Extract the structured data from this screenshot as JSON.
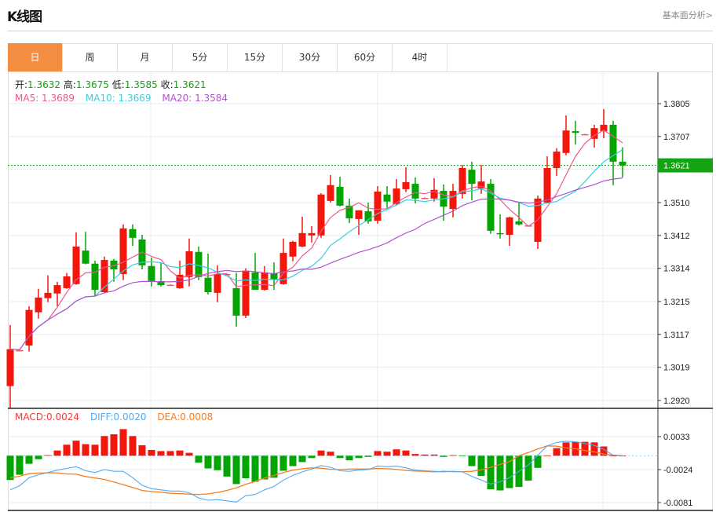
{
  "header": {
    "title": "K线图",
    "link": "基本面分析>"
  },
  "tabs": [
    {
      "label": "日",
      "active": true
    },
    {
      "label": "周"
    },
    {
      "label": "月"
    },
    {
      "label": "5分"
    },
    {
      "label": "15分"
    },
    {
      "label": "30分"
    },
    {
      "label": "60分"
    },
    {
      "label": "4时"
    }
  ],
  "ohlc_info": {
    "open_label": "开:",
    "open": "1.3632",
    "high_label": "高:",
    "high": "1.3675",
    "low_label": "低:",
    "low": "1.3585",
    "close_label": "收:",
    "close": "1.3621"
  },
  "ma_info": {
    "ma5": "MA5: 1.3689",
    "ma10": "MA10: 1.3669",
    "ma20": "MA20: 1.3584"
  },
  "macd_info": {
    "macd": "MACD:0.0024",
    "diff": "DIFF:0.0020",
    "dea": "DEA:0.0008"
  },
  "colors": {
    "up": "#f3160b",
    "down": "#02a502",
    "doji": "#f05a5a",
    "ma5": "#f2578d",
    "ma10": "#3ccde0",
    "ma20": "#b154cc",
    "diff": "#55aaf0",
    "dea": "#f57e22",
    "current": "#13a313",
    "accent": "#f38d3f"
  },
  "chart_data": {
    "type": "candlestick",
    "price_axis": {
      "ticks": [
        "1.3805",
        "1.3707",
        "1.3610",
        "1.3510",
        "1.3412",
        "1.3314",
        "1.3215",
        "1.3117",
        "1.3019",
        "1.2920"
      ],
      "range": [
        1.292,
        1.3805
      ]
    },
    "current_price": "1.3621",
    "candles_ohlc": [
      [
        1.2963,
        1.3145,
        1.2897,
        1.3073
      ],
      [
        1.307,
        1.3072,
        1.3068,
        1.307
      ],
      [
        1.3084,
        1.3201,
        1.3066,
        1.319
      ],
      [
        1.3183,
        1.3253,
        1.3164,
        1.3227
      ],
      [
        1.3225,
        1.3293,
        1.3213,
        1.3241
      ],
      [
        1.3239,
        1.3274,
        1.3201,
        1.3264
      ],
      [
        1.3255,
        1.33,
        1.3253,
        1.329
      ],
      [
        1.3267,
        1.3421,
        1.3265,
        1.3379
      ],
      [
        1.3367,
        1.3423,
        1.3326,
        1.3328
      ],
      [
        1.3328,
        1.3337,
        1.3232,
        1.325
      ],
      [
        1.3243,
        1.3349,
        1.324,
        1.3339
      ],
      [
        1.3337,
        1.3342,
        1.3274,
        1.3311
      ],
      [
        1.3297,
        1.3445,
        1.3279,
        1.3433
      ],
      [
        1.3431,
        1.3445,
        1.3381,
        1.3405
      ],
      [
        1.34,
        1.3414,
        1.3311,
        1.3323
      ],
      [
        1.3321,
        1.3346,
        1.326,
        1.3276
      ],
      [
        1.3276,
        1.333,
        1.326,
        1.3264
      ],
      [
        1.3265,
        1.3267,
        1.3263,
        1.3265
      ],
      [
        1.3255,
        1.3337,
        1.3253,
        1.3295
      ],
      [
        1.3288,
        1.3403,
        1.326,
        1.3365
      ],
      [
        1.3363,
        1.3379,
        1.3279,
        1.3288
      ],
      [
        1.3286,
        1.3358,
        1.3236,
        1.3243
      ],
      [
        1.3241,
        1.3323,
        1.3213,
        1.3297
      ],
      [
        1.3297,
        1.3299,
        1.3295,
        1.3297
      ],
      [
        1.3255,
        1.33,
        1.314,
        1.3173
      ],
      [
        1.3173,
        1.3314,
        1.3166,
        1.3307
      ],
      [
        1.3302,
        1.336,
        1.325,
        1.325
      ],
      [
        1.325,
        1.3321,
        1.3248,
        1.3302
      ],
      [
        1.33,
        1.3332,
        1.325,
        1.3281
      ],
      [
        1.3267,
        1.3403,
        1.3265,
        1.336
      ],
      [
        1.3349,
        1.3396,
        1.3335,
        1.3393
      ],
      [
        1.3379,
        1.3468,
        1.3377,
        1.3419
      ],
      [
        1.3412,
        1.344,
        1.3391,
        1.3419
      ],
      [
        1.3412,
        1.3538,
        1.3405,
        1.3534
      ],
      [
        1.3515,
        1.3592,
        1.351,
        1.3562
      ],
      [
        1.3557,
        1.3587,
        1.3499,
        1.3501
      ],
      [
        1.3501,
        1.3522,
        1.3449,
        1.3463
      ],
      [
        1.3461,
        1.3487,
        1.3414,
        1.3487
      ],
      [
        1.3484,
        1.351,
        1.3447,
        1.3454
      ],
      [
        1.3456,
        1.3559,
        1.3447,
        1.3543
      ],
      [
        1.3534,
        1.3559,
        1.3494,
        1.3513
      ],
      [
        1.3505,
        1.358,
        1.3501,
        1.3552
      ],
      [
        1.355,
        1.3615,
        1.3541,
        1.3571
      ],
      [
        1.3566,
        1.3585,
        1.3508,
        1.3522
      ],
      [
        1.3524,
        1.3526,
        1.3522,
        1.3524
      ],
      [
        1.3522,
        1.3583,
        1.3513,
        1.3548
      ],
      [
        1.3545,
        1.3564,
        1.3456,
        1.3498
      ],
      [
        1.3491,
        1.3566,
        1.3466,
        1.3545
      ],
      [
        1.3536,
        1.3622,
        1.3522,
        1.3613
      ],
      [
        1.3608,
        1.3632,
        1.3517,
        1.3566
      ],
      [
        1.3552,
        1.3622,
        1.3536,
        1.3573
      ],
      [
        1.3566,
        1.358,
        1.3417,
        1.3426
      ],
      [
        1.3419,
        1.3475,
        1.3403,
        1.3417
      ],
      [
        1.3414,
        1.3468,
        1.3381,
        1.3466
      ],
      [
        1.3454,
        1.351,
        1.3442,
        1.3445
      ],
      [
        1.3442,
        1.3443,
        1.3441,
        1.3442
      ],
      [
        1.3393,
        1.3531,
        1.3372,
        1.3522
      ],
      [
        1.351,
        1.3648,
        1.3508,
        1.3613
      ],
      [
        1.3613,
        1.3672,
        1.359,
        1.3662
      ],
      [
        1.3658,
        1.377,
        1.3651,
        1.3725
      ],
      [
        1.3723,
        1.3754,
        1.3683,
        1.3718
      ],
      [
        1.3714,
        1.3715,
        1.3713,
        1.3714
      ],
      [
        1.37,
        1.3742,
        1.3674,
        1.3732
      ],
      [
        1.3723,
        1.3789,
        1.3702,
        1.3742
      ],
      [
        1.3742,
        1.3754,
        1.3562,
        1.3632
      ],
      [
        1.3632,
        1.3675,
        1.3585,
        1.3621
      ]
    ],
    "ma_periods": [
      5,
      10,
      20
    ],
    "macd_axis": {
      "ticks": [
        "0.0033",
        "-0.0024",
        "-0.0081"
      ],
      "range": [
        -0.0081,
        0.0033
      ]
    },
    "macd_hist": [
      -0.0042,
      -0.0033,
      -0.0014,
      -0.0006,
      0.0001,
      0.0009,
      0.0019,
      0.0026,
      0.002,
      0.0019,
      0.0034,
      0.0037,
      0.0046,
      0.0034,
      0.0018,
      0.001,
      0.0008,
      0.0008,
      0.0009,
      0.0005,
      -0.0012,
      -0.0022,
      -0.0025,
      -0.0036,
      -0.0049,
      -0.0039,
      -0.0045,
      -0.0041,
      -0.0038,
      -0.0026,
      -0.0018,
      -0.0011,
      -0.0004,
      0.0009,
      0.0007,
      -0.0004,
      -0.0008,
      -0.0004,
      -0.0002,
      0.0008,
      0.0007,
      0.0011,
      0.0009,
      0.0003,
      0.0002,
      0.0002,
      -0.0002,
      0.0001,
      -0.0001,
      -0.0018,
      -0.0035,
      -0.0058,
      -0.006,
      -0.0056,
      -0.0054,
      -0.0043,
      -0.0021,
      0.0,
      0.0013,
      0.0023,
      0.0024,
      0.0024,
      0.0023,
      0.0016,
      0.0,
      0.0
    ],
    "diff": [
      -0.0059,
      -0.0052,
      -0.0038,
      -0.0033,
      -0.0029,
      -0.0025,
      -0.0022,
      -0.0019,
      -0.0026,
      -0.0029,
      -0.0024,
      -0.0027,
      -0.0027,
      -0.0038,
      -0.0051,
      -0.0057,
      -0.0059,
      -0.0061,
      -0.0061,
      -0.0064,
      -0.0073,
      -0.0077,
      -0.0076,
      -0.0078,
      -0.008,
      -0.0069,
      -0.0067,
      -0.0059,
      -0.0053,
      -0.0042,
      -0.0034,
      -0.0028,
      -0.0023,
      -0.0017,
      -0.002,
      -0.0026,
      -0.0027,
      -0.0025,
      -0.0024,
      -0.0018,
      -0.0019,
      -0.0018,
      -0.0021,
      -0.0025,
      -0.0026,
      -0.0027,
      -0.0028,
      -0.0027,
      -0.0028,
      -0.0036,
      -0.0042,
      -0.0049,
      -0.0045,
      -0.0038,
      -0.0027,
      -0.0016,
      0.0001,
      0.0017,
      0.0023,
      0.0025,
      0.0024,
      0.0021,
      0.0018,
      0.0011,
      0.0001,
      0.0
    ]
  }
}
